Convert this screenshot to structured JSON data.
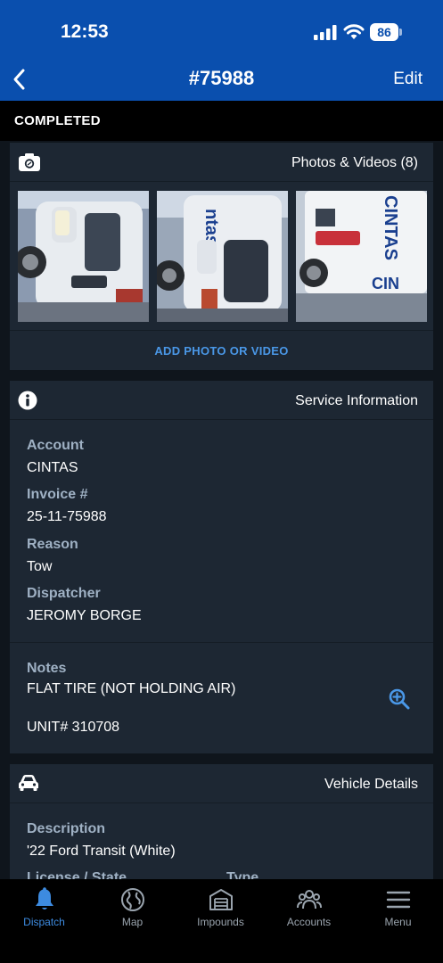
{
  "status_bar": {
    "time": "12:53",
    "battery": "86"
  },
  "nav": {
    "title": "#75988",
    "edit_label": "Edit"
  },
  "job_status": "COMPLETED",
  "photos": {
    "title": "Photos & Videos (8)",
    "add_label": "ADD PHOTO OR VIDEO",
    "thumbnails": [
      "photo-1",
      "photo-2",
      "photo-3"
    ]
  },
  "service": {
    "title": "Service Information",
    "account_label": "Account",
    "account_value": "CINTAS",
    "invoice_label": "Invoice #",
    "invoice_value": "25-11-75988",
    "reason_label": "Reason",
    "reason_value": "Tow",
    "dispatcher_label": "Dispatcher",
    "dispatcher_value": "JEROMY BORGE",
    "notes_label": "Notes",
    "notes_line1": "FLAT TIRE (NOT HOLDING AIR)",
    "notes_line2": "UNIT# 310708"
  },
  "vehicle": {
    "title": "Vehicle Details",
    "description_label": "Description",
    "description_value": "'22 Ford Transit (White)",
    "license_label": "License / State",
    "type_label": "Type"
  },
  "tabs": [
    {
      "label": "Dispatch",
      "icon": "bell-icon",
      "active": true
    },
    {
      "label": "Map",
      "icon": "globe-icon",
      "active": false
    },
    {
      "label": "Impounds",
      "icon": "garage-icon",
      "active": false
    },
    {
      "label": "Accounts",
      "icon": "people-icon",
      "active": false
    },
    {
      "label": "Menu",
      "icon": "hamburger-icon",
      "active": false
    }
  ],
  "colors": {
    "header": "#0a4fae",
    "card": "#1d2733",
    "accent": "#4a98e8",
    "label": "#9fb1c4"
  }
}
